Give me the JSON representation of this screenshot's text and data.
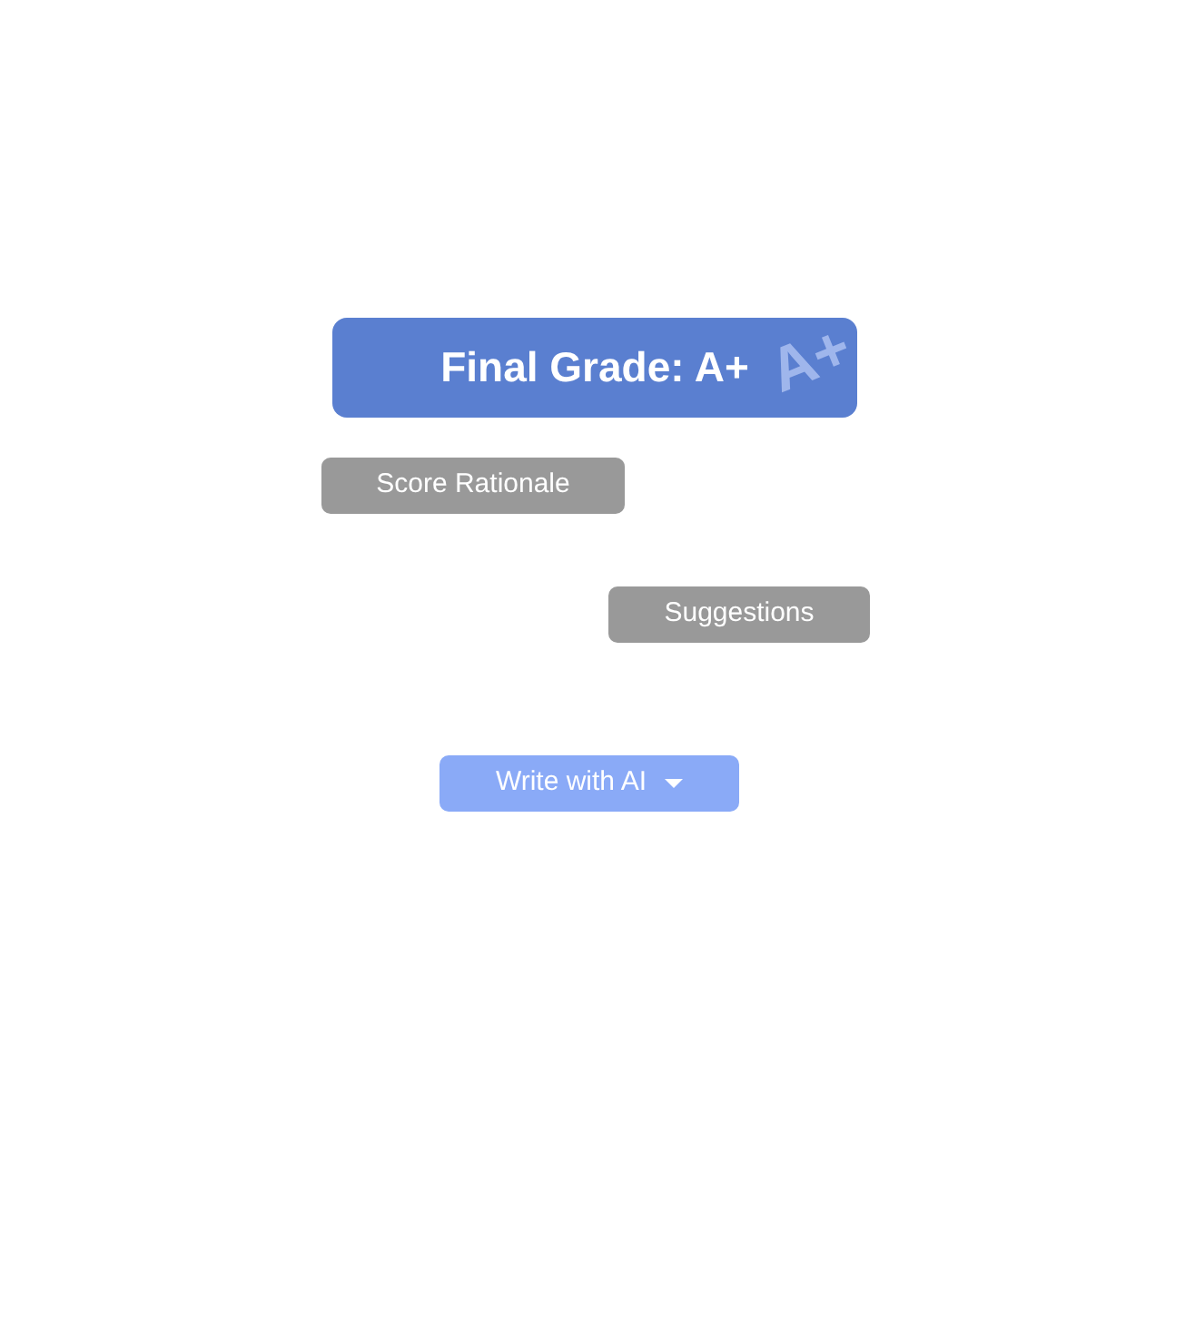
{
  "grade_banner": {
    "title": "Final Grade: A+",
    "decoration": "A+"
  },
  "buttons": [
    {
      "label": "Score Rationale"
    },
    {
      "label": "Suggestions"
    }
  ],
  "ai_button": {
    "label": "Write with AI"
  }
}
